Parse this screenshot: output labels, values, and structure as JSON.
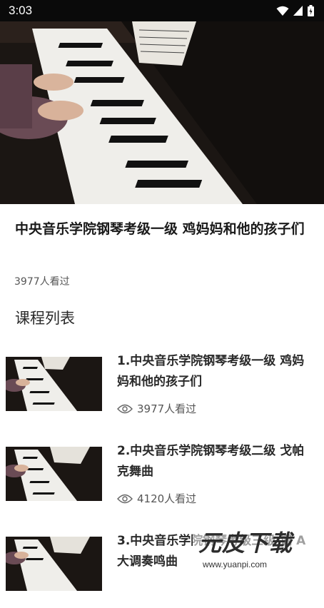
{
  "status_bar": {
    "time": "3:03"
  },
  "video": {
    "title": "中央音乐学院钢琴考级一级 鸡妈妈和他的孩子们",
    "views": "3977人看过"
  },
  "course_list": {
    "heading": "课程列表",
    "items": [
      {
        "title": "1.中央音乐学院钢琴考级一级 鸡妈妈和他的孩子们",
        "views": "3977人看过"
      },
      {
        "title": "2.中央音乐学院钢琴考级二级 戈帕克舞曲",
        "views": "4120人看过"
      },
      {
        "title": "3.中央音乐学院钢琴考级三级 调 A大调奏鸣曲",
        "views": ""
      }
    ]
  },
  "watermark": {
    "brand": "元皮下载",
    "url": "www.yuanpi.com"
  },
  "icons": {
    "wifi": "wifi-icon",
    "signal": "signal-icon",
    "battery": "battery-icon",
    "eye": "eye-icon"
  }
}
